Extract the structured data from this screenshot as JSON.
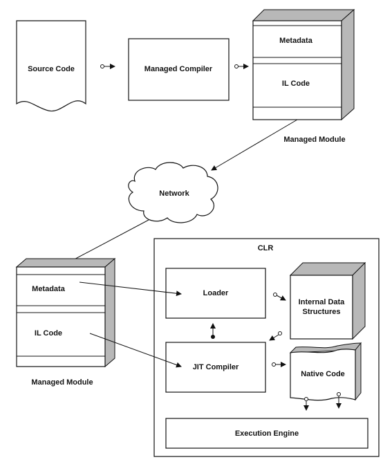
{
  "diagram": {
    "source_code": "Source Code",
    "managed_compiler": "Managed Compiler",
    "module_top": {
      "metadata": "Metadata",
      "il_code": "IL Code",
      "label": "Managed Module"
    },
    "network": "Network",
    "module_bottom": {
      "metadata": "Metadata",
      "il_code": "IL Code",
      "label": "Managed Module"
    },
    "clr": {
      "title": "CLR",
      "loader": "Loader",
      "internal_data_1": "Internal Data",
      "internal_data_2": "Structures",
      "jit_compiler": "JIT Compiler",
      "native_code": "Native Code",
      "execution_engine": "Execution Engine"
    },
    "colors": {
      "line": "#111111",
      "shade": "#b8b8b8"
    }
  }
}
